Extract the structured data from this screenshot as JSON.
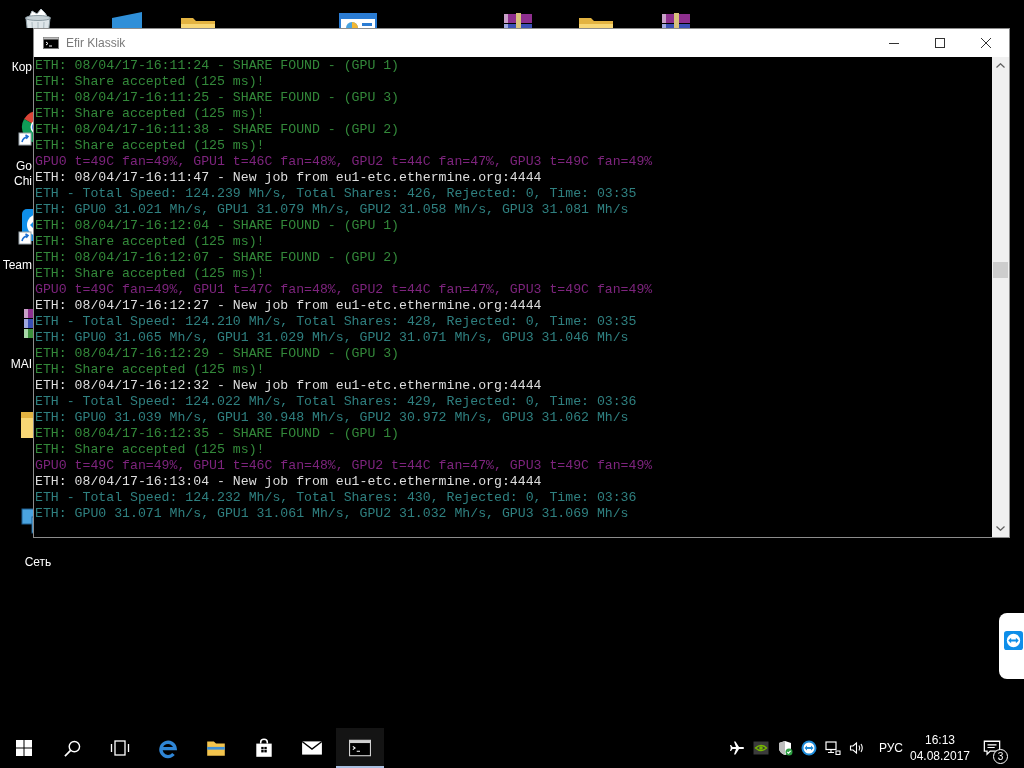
{
  "desktop": {
    "icons": [
      {
        "kind": "recycle_bin",
        "label_lines": [
          "Кор"
        ]
      },
      {
        "kind": "browser_shortcut",
        "label_lines": [
          "Go",
          "Chi"
        ]
      },
      {
        "kind": "remote_shortcut",
        "label_lines": [
          "Team"
        ]
      },
      {
        "kind": "archive",
        "label_lines": [
          "MAI"
        ]
      },
      {
        "kind": "folder"
      },
      {
        "kind": "network",
        "label_lines": [
          "Сеть"
        ]
      }
    ]
  },
  "window": {
    "title": "Efir Klassik"
  },
  "console": {
    "lines": [
      {
        "kind": "share_found",
        "text": "ETH: 08/04/17-16:11:24 - SHARE FOUND - (GPU 1)"
      },
      {
        "kind": "share_accepted",
        "text": "ETH: Share accepted (125 ms)!"
      },
      {
        "kind": "share_found",
        "text": "ETH: 08/04/17-16:11:25 - SHARE FOUND - (GPU 3)"
      },
      {
        "kind": "share_accepted",
        "text": "ETH: Share accepted (125 ms)!"
      },
      {
        "kind": "share_found",
        "text": "ETH: 08/04/17-16:11:38 - SHARE FOUND - (GPU 2)"
      },
      {
        "kind": "share_accepted",
        "text": "ETH: Share accepted (125 ms)!"
      },
      {
        "kind": "gpu_stats",
        "text": "GPU0 t=49C fan=49%, GPU1 t=46C fan=48%, GPU2 t=44C fan=47%, GPU3 t=49C fan=49%"
      },
      {
        "kind": "new_job",
        "text": "ETH: 08/04/17-16:11:47 - New job from eu1-etc.ethermine.org:4444"
      },
      {
        "kind": "total_speed",
        "text": "ETH - Total Speed: 124.239 Mh/s, Total Shares: 426, Rejected: 0, Time: 03:35"
      },
      {
        "kind": "gpu_speed",
        "text": "ETH: GPU0 31.021 Mh/s, GPU1 31.079 Mh/s, GPU2 31.058 Mh/s, GPU3 31.081 Mh/s"
      },
      {
        "kind": "share_found",
        "text": "ETH: 08/04/17-16:12:04 - SHARE FOUND - (GPU 1)"
      },
      {
        "kind": "share_accepted",
        "text": "ETH: Share accepted (125 ms)!"
      },
      {
        "kind": "share_found",
        "text": "ETH: 08/04/17-16:12:07 - SHARE FOUND - (GPU 2)"
      },
      {
        "kind": "share_accepted",
        "text": "ETH: Share accepted (125 ms)!"
      },
      {
        "kind": "gpu_stats",
        "text": "GPU0 t=49C fan=49%, GPU1 t=47C fan=48%, GPU2 t=44C fan=47%, GPU3 t=49C fan=49%"
      },
      {
        "kind": "new_job",
        "text": "ETH: 08/04/17-16:12:27 - New job from eu1-etc.ethermine.org:4444"
      },
      {
        "kind": "total_speed",
        "text": "ETH - Total Speed: 124.210 Mh/s, Total Shares: 428, Rejected: 0, Time: 03:35"
      },
      {
        "kind": "gpu_speed",
        "text": "ETH: GPU0 31.065 Mh/s, GPU1 31.029 Mh/s, GPU2 31.071 Mh/s, GPU3 31.046 Mh/s"
      },
      {
        "kind": "share_found",
        "text": "ETH: 08/04/17-16:12:29 - SHARE FOUND - (GPU 3)"
      },
      {
        "kind": "share_accepted",
        "text": "ETH: Share accepted (125 ms)!"
      },
      {
        "kind": "new_job",
        "text": "ETH: 08/04/17-16:12:32 - New job from eu1-etc.ethermine.org:4444"
      },
      {
        "kind": "total_speed",
        "text": "ETH - Total Speed: 124.022 Mh/s, Total Shares: 429, Rejected: 0, Time: 03:36"
      },
      {
        "kind": "gpu_speed",
        "text": "ETH: GPU0 31.039 Mh/s, GPU1 30.948 Mh/s, GPU2 30.972 Mh/s, GPU3 31.062 Mh/s"
      },
      {
        "kind": "share_found",
        "text": "ETH: 08/04/17-16:12:35 - SHARE FOUND - (GPU 1)"
      },
      {
        "kind": "share_accepted",
        "text": "ETH: Share accepted (125 ms)!"
      },
      {
        "kind": "gpu_stats",
        "text": "GPU0 t=49C fan=49%, GPU1 t=46C fan=48%, GPU2 t=44C fan=47%, GPU3 t=49C fan=49%"
      },
      {
        "kind": "new_job",
        "text": "ETH: 08/04/17-16:13:04 - New job from eu1-etc.ethermine.org:4444"
      },
      {
        "kind": "total_speed",
        "text": "ETH - Total Speed: 124.232 Mh/s, Total Shares: 430, Rejected: 0, Time: 03:36"
      },
      {
        "kind": "gpu_speed",
        "text": "ETH: GPU0 31.071 Mh/s, GPU1 31.061 Mh/s, GPU2 31.032 Mh/s, GPU3 31.069 Mh/s"
      }
    ]
  },
  "taskbar": {
    "apps": [
      {
        "kind": "browser",
        "open": false
      },
      {
        "kind": "files",
        "open": false
      },
      {
        "kind": "store",
        "open": false
      },
      {
        "kind": "mail",
        "open": false
      },
      {
        "kind": "console",
        "open": true
      }
    ],
    "language": "РУС",
    "time": "16:13",
    "date": "04.08.2017",
    "notifications": "3"
  }
}
